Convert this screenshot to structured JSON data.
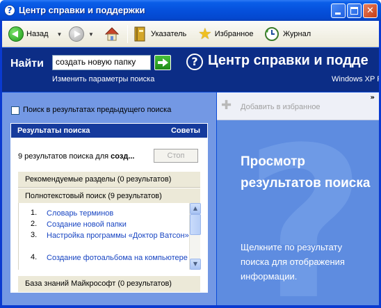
{
  "window": {
    "title": "Центр справки и поддержки",
    "title_icon": "?",
    "controls": {
      "minimize": "_",
      "maximize": "□",
      "close": "✕"
    }
  },
  "toolbar": {
    "back_label": "Назад",
    "forward_label": "",
    "index_label": "Указатель",
    "favorites_label": "Избранное",
    "history_label": "Журнал",
    "icons": [
      "back-arrow-icon",
      "forward-arrow-icon",
      "home-icon",
      "book-icon",
      "star-icon",
      "history-icon"
    ]
  },
  "search": {
    "find_label": "Найти",
    "query": "создать новую папку",
    "change_params_link": "Изменить параметры поиска"
  },
  "header": {
    "help_center_title": "Центр справки и подде",
    "winxp_label": "Windows XP P"
  },
  "left_pane": {
    "search_previous_label": "Поиск в результатах предыдущего поиска",
    "search_previous_checked": false,
    "results_title": "Результаты поиска",
    "tips_link": "Советы",
    "count_text": "9 результатов поиска для",
    "count_query": "созд...",
    "stop_label": "Стоп",
    "sections": {
      "recommended": "Рекомендуемые разделы (0 результатов)",
      "fulltext": "Полнотекстовый поиск (9 результатов)",
      "kb": "База знаний Майкрософт (0 результатов)"
    },
    "results": [
      {
        "num": "1.",
        "title": "Словарь терминов"
      },
      {
        "num": "2.",
        "title": "Создание новой папки"
      },
      {
        "num": "3.",
        "title": "Настройка программы «Доктор Ватсон»"
      },
      {
        "num": "4.",
        "title": "Создание фотоальбома на компьютере"
      }
    ]
  },
  "right_pane": {
    "add_favorites_label": "Добавить в избранное",
    "view_title": "Просмотр результатов поиска",
    "view_desc": "Щелкните по результату поиска для отображения информации."
  },
  "colors": {
    "titlebar": "#0550dc",
    "band": "#0c2d86",
    "left_pane": "#7398e4",
    "right_pane": "#5e8ce0",
    "link": "#1845c2"
  }
}
